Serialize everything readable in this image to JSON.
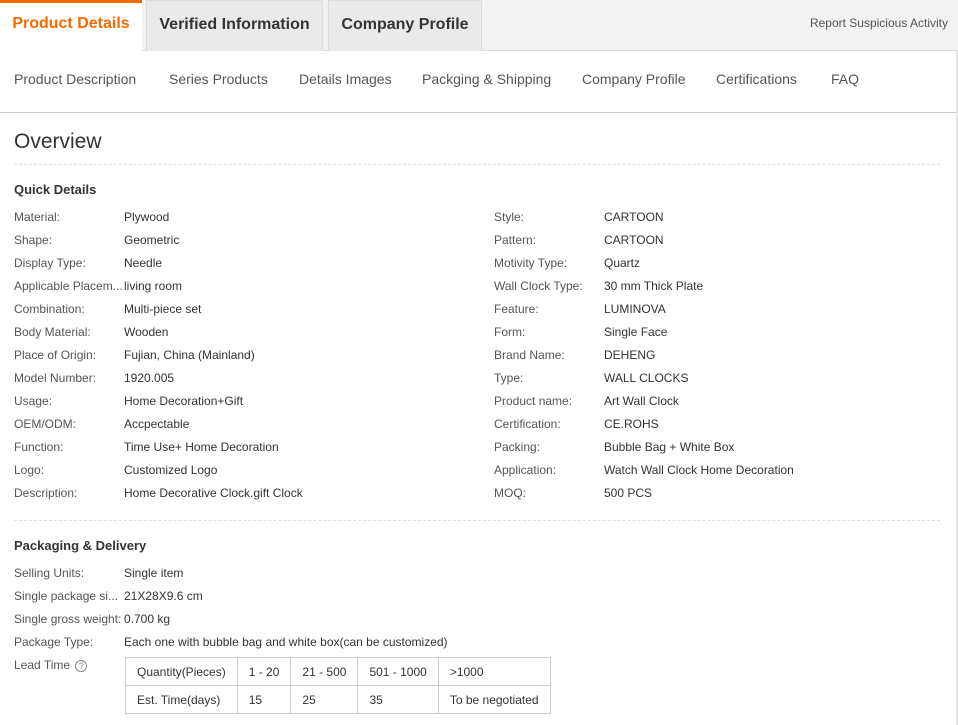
{
  "tabs": {
    "active": "Product Details",
    "items": [
      "Product Details",
      "Verified Information",
      "Company Profile"
    ]
  },
  "report_link": "Report Suspicious Activity",
  "subnav": [
    "Product Description",
    "Series Products",
    "Details Images",
    "Packging & Shipping",
    "Company Profile",
    "Certifications",
    "FAQ"
  ],
  "overview": {
    "title": "Overview",
    "quick_details": {
      "title": "Quick Details",
      "left": [
        {
          "label": "Material:",
          "value": "Plywood"
        },
        {
          "label": "Shape:",
          "value": "Geometric"
        },
        {
          "label": "Display Type:",
          "value": "Needle"
        },
        {
          "label": "Applicable Placem...",
          "value": "living room"
        },
        {
          "label": "Combination:",
          "value": "Multi-piece set"
        },
        {
          "label": "Body Material:",
          "value": "Wooden"
        },
        {
          "label": "Place of Origin:",
          "value": "Fujian, China (Mainland)"
        },
        {
          "label": "Model Number:",
          "value": "1920.005"
        },
        {
          "label": "Usage:",
          "value": "Home Decoration+Gift"
        },
        {
          "label": "OEM/ODM:",
          "value": "Accpectable"
        },
        {
          "label": "Function:",
          "value": "Time Use+ Home Decoration"
        },
        {
          "label": "Logo:",
          "value": "Customized Logo"
        },
        {
          "label": "Description:",
          "value": "Home Decorative Clock.gift Clock"
        }
      ],
      "right": [
        {
          "label": "Style:",
          "value": "CARTOON"
        },
        {
          "label": "Pattern:",
          "value": "CARTOON"
        },
        {
          "label": "Motivity Type:",
          "value": "Quartz"
        },
        {
          "label": "Wall Clock Type:",
          "value": "30 mm Thick Plate"
        },
        {
          "label": "Feature:",
          "value": "LUMINOVA"
        },
        {
          "label": "Form:",
          "value": "Single Face"
        },
        {
          "label": "Brand Name:",
          "value": "DEHENG"
        },
        {
          "label": "Type:",
          "value": "WALL CLOCKS"
        },
        {
          "label": "Product name:",
          "value": "Art Wall Clock"
        },
        {
          "label": "Certification:",
          "value": "CE.ROHS"
        },
        {
          "label": "Packing:",
          "value": "Bubble Bag + White Box"
        },
        {
          "label": "Application:",
          "value": "Watch Wall Clock Home Decoration"
        },
        {
          "label": "MOQ:",
          "value": "500 PCS"
        }
      ]
    },
    "packaging": {
      "title": "Packaging & Delivery",
      "rows": [
        {
          "label": "Selling Units:",
          "value": "Single item"
        },
        {
          "label": "Single package si...",
          "value": "21X28X9.6 cm"
        },
        {
          "label": "Single gross weight:",
          "value": "0.700 kg"
        },
        {
          "label": "Package Type:",
          "value": "Each one with bubble bag and white box(can be customized)"
        }
      ],
      "lead_time_label": "Lead Time",
      "help_icon": "?",
      "lead_table": {
        "header": [
          "Quantity(Pieces)",
          "1 - 20",
          "21 - 500",
          "501 - 1000",
          ">1000"
        ],
        "row": [
          "Est. Time(days)",
          "15",
          "25",
          "35",
          "To be negotiated"
        ]
      }
    }
  }
}
